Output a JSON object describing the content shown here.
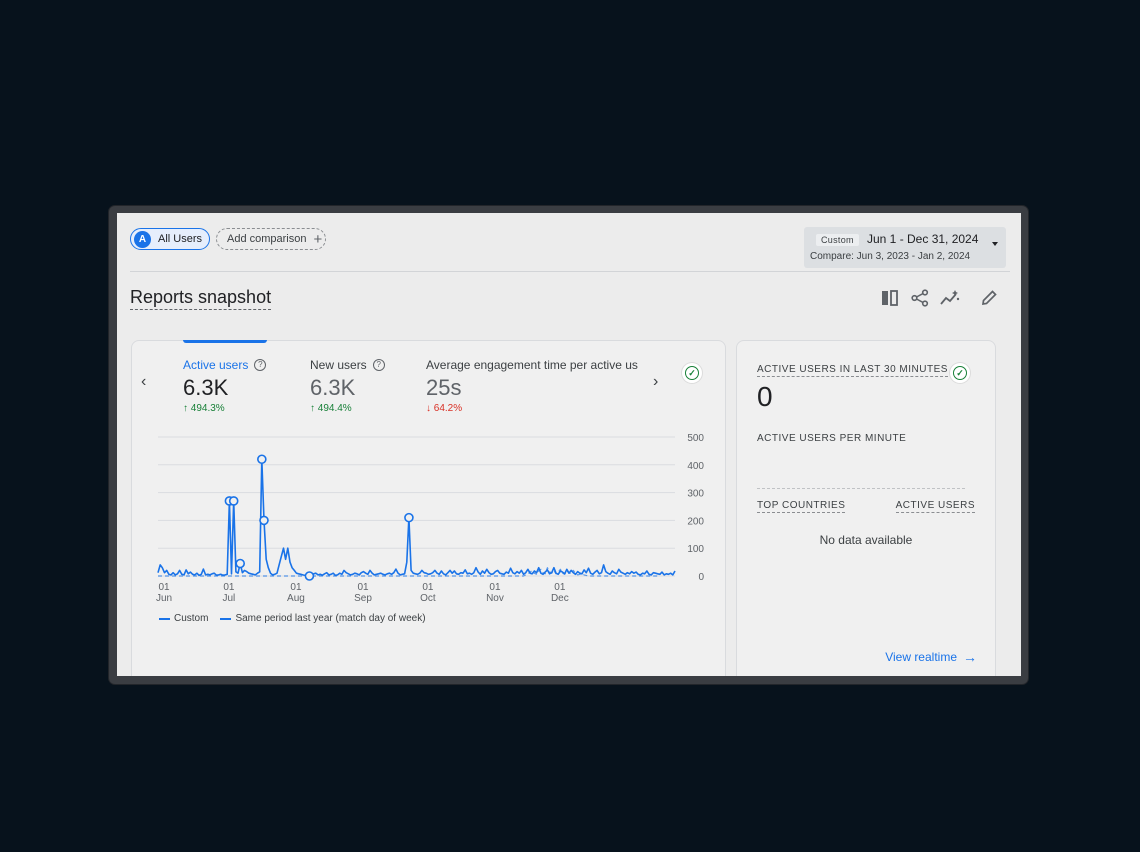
{
  "toolbar": {
    "avatar_letter": "A",
    "all_users": "All Users",
    "add_comparison": "Add comparison",
    "date_tag": "Custom",
    "date_range": "Jun 1 - Dec 31, 2024",
    "compare_range": "Compare: Jun 3, 2023 - Jan 2, 2024"
  },
  "page_title": "Reports snapshot",
  "header_icons": [
    "compare-columns-icon",
    "share-icon",
    "insights-icon",
    "edit-pencil-icon"
  ],
  "metrics": [
    {
      "label": "Active users",
      "value": "6.3K",
      "change": "494.3%",
      "direction": "up",
      "active": true
    },
    {
      "label": "New users",
      "value": "6.3K",
      "change": "494.4%",
      "direction": "up",
      "active": false
    },
    {
      "label": "Average engagement time per active us",
      "value": "25s",
      "change": "64.2%",
      "direction": "down",
      "active": false
    }
  ],
  "chart_data": {
    "type": "line",
    "x_tick_labels": [
      [
        "01",
        "Jun"
      ],
      [
        "01",
        "Jul"
      ],
      [
        "01",
        "Aug"
      ],
      [
        "01",
        "Sep"
      ],
      [
        "01",
        "Oct"
      ],
      [
        "01",
        "Nov"
      ],
      [
        "01",
        "Dec"
      ]
    ],
    "y_tick_labels": [
      "500",
      "400",
      "300",
      "200",
      "100",
      "0"
    ],
    "ylim": [
      0,
      500
    ],
    "series": [
      {
        "name": "Custom",
        "style": "solid",
        "color": "#1a73e8",
        "values": [
          12,
          40,
          30,
          12,
          20,
          6,
          4,
          12,
          4,
          8,
          20,
          6,
          4,
          22,
          8,
          14,
          6,
          4,
          10,
          2,
          6,
          25,
          4,
          6,
          4,
          8,
          10,
          3,
          4,
          6,
          3,
          4,
          6,
          270,
          8,
          270,
          15,
          10,
          45,
          12,
          20,
          16,
          10,
          8,
          6,
          4,
          10,
          15,
          420,
          200,
          60,
          30,
          10,
          4,
          6,
          10,
          40,
          70,
          100,
          60,
          100,
          50,
          30,
          20,
          10,
          8,
          6,
          4,
          2,
          8,
          0,
          4,
          8,
          10,
          4,
          6,
          3,
          8,
          12,
          4,
          6,
          10,
          2,
          4,
          10,
          6,
          20,
          12,
          8,
          4,
          6,
          10,
          8,
          4,
          12,
          16,
          10,
          6,
          20,
          10,
          4,
          6,
          8,
          10,
          6,
          4,
          8,
          10,
          6,
          12,
          25,
          10,
          4,
          6,
          8,
          50,
          210,
          20,
          10,
          8,
          6,
          10,
          20,
          12,
          10,
          6,
          8,
          12,
          20,
          10,
          6,
          18,
          8,
          4,
          12,
          20,
          10,
          18,
          8,
          6,
          12,
          10,
          22,
          8,
          10,
          6,
          12,
          30,
          14,
          6,
          18,
          10,
          24,
          12,
          6,
          8,
          16,
          20,
          10,
          8,
          6,
          14,
          10,
          28,
          12,
          8,
          16,
          10,
          20,
          6,
          12,
          24,
          10,
          8,
          18,
          12,
          30,
          10,
          6,
          14,
          22,
          8,
          12,
          30,
          10,
          6,
          18,
          14,
          8,
          24,
          10,
          20,
          12,
          6,
          16,
          10,
          8,
          22,
          12,
          28,
          10,
          6,
          14,
          20,
          8,
          12,
          40,
          16,
          10,
          6,
          18,
          12,
          8,
          24,
          14,
          10,
          6,
          12,
          8,
          16,
          10,
          14,
          6,
          4,
          10,
          8,
          18,
          6,
          4,
          12,
          10,
          8,
          6,
          14,
          4,
          8,
          6,
          10,
          4,
          18
        ]
      },
      {
        "name": "Same period last year (match day of week)",
        "style": "dashed",
        "color": "#1a73e8",
        "values": [
          0,
          0,
          0,
          0,
          0,
          0,
          0,
          0,
          0,
          0,
          0,
          0,
          0,
          0,
          0,
          0,
          0,
          0,
          0,
          0,
          0,
          0,
          0,
          0,
          0,
          0,
          0,
          0,
          0,
          0,
          0,
          0,
          0,
          0,
          0,
          0,
          0,
          0,
          0,
          0,
          0,
          0,
          0,
          0,
          0,
          0,
          0,
          0,
          0,
          0,
          0,
          0,
          0,
          0,
          0,
          0,
          0,
          0,
          0,
          0,
          0,
          0,
          0,
          0,
          0,
          0,
          0,
          0,
          0,
          0,
          0,
          0,
          0,
          0,
          0,
          0,
          0,
          0,
          0,
          0,
          0,
          0,
          0,
          0,
          0,
          0,
          0,
          0,
          0,
          0,
          0,
          0,
          0,
          0,
          0,
          0,
          0,
          0,
          0,
          0,
          0,
          0,
          0,
          0,
          0,
          0,
          0,
          0,
          0,
          0,
          0,
          0,
          0,
          0,
          0,
          0,
          0,
          0,
          0,
          0,
          0,
          0,
          0,
          0,
          0,
          0,
          0,
          0,
          0,
          0,
          0,
          0,
          0,
          0,
          0,
          0,
          0,
          0,
          0,
          0,
          0,
          0,
          0,
          0,
          0,
          0,
          0,
          0,
          0,
          0,
          0,
          0,
          0,
          0,
          0,
          0,
          0,
          0,
          0,
          0,
          0,
          0,
          0,
          0,
          0,
          0,
          0,
          0,
          0,
          0,
          4,
          8,
          14,
          20,
          10,
          6,
          18,
          24,
          12,
          8,
          30,
          16,
          10,
          20,
          8,
          14,
          24,
          10,
          6,
          18,
          12,
          8,
          20,
          10,
          4,
          6,
          8,
          4,
          2,
          0,
          0,
          0,
          0,
          0,
          0,
          0,
          0,
          0,
          0,
          0,
          0,
          0,
          0,
          0,
          0,
          0,
          0,
          0,
          0,
          0,
          0,
          0,
          0,
          0,
          0,
          0,
          0,
          0,
          0,
          0,
          0,
          0,
          0
        ]
      }
    ],
    "point_markers": [
      {
        "index": 33,
        "value": 270
      },
      {
        "index": 35,
        "value": 270
      },
      {
        "index": 38,
        "value": 45
      },
      {
        "index": 48,
        "value": 420
      },
      {
        "index": 49,
        "value": 200
      },
      {
        "index": 70,
        "value": 0
      },
      {
        "index": 116,
        "value": 210
      }
    ]
  },
  "legend": {
    "custom": "Custom",
    "same_period": "Same period last year (match day of week)"
  },
  "realtime": {
    "heading": "ACTIVE USERS IN LAST 30 MINUTES",
    "count": "0",
    "per_minute": "ACTIVE USERS PER MINUTE",
    "col_countries": "TOP COUNTRIES",
    "col_users": "ACTIVE USERS",
    "no_data": "No data available",
    "link": "View realtime"
  }
}
